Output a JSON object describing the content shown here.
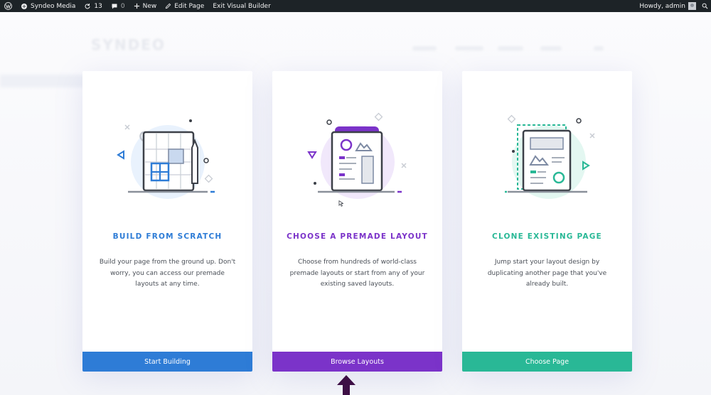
{
  "adminbar": {
    "site_name": "Syndeo Media",
    "updates_count": "13",
    "comments_count": "0",
    "new_label": "New",
    "edit_label": "Edit Page",
    "exit_label": "Exit Visual Builder",
    "greeting": "Howdy, admin"
  },
  "background": {
    "logo_text": "SYNDEO"
  },
  "cards": [
    {
      "title": "BUILD FROM SCRATCH",
      "description": "Build your page from the ground up. Don't worry, you can access our premade layouts at any time.",
      "button_label": "Start Building",
      "accent_color": "#2e7cd6"
    },
    {
      "title": "CHOOSE A PREMADE LAYOUT",
      "description": "Choose from hundreds of world-class premade layouts or start from any of your existing saved layouts.",
      "button_label": "Browse Layouts",
      "accent_color": "#7b33c9"
    },
    {
      "title": "CLONE EXISTING PAGE",
      "description": "Jump start your layout design by duplicating another page that you've already built.",
      "button_label": "Choose Page",
      "accent_color": "#29b896"
    }
  ],
  "icons": {
    "wordpress": "wordpress-icon",
    "home": "home-icon",
    "updates": "refresh-icon",
    "comments": "comment-icon",
    "new": "plus-icon",
    "edit": "pencil-icon",
    "search": "search-icon"
  },
  "colors": {
    "adminbar_bg": "#1d2327",
    "arrow": "#3d0f45"
  }
}
